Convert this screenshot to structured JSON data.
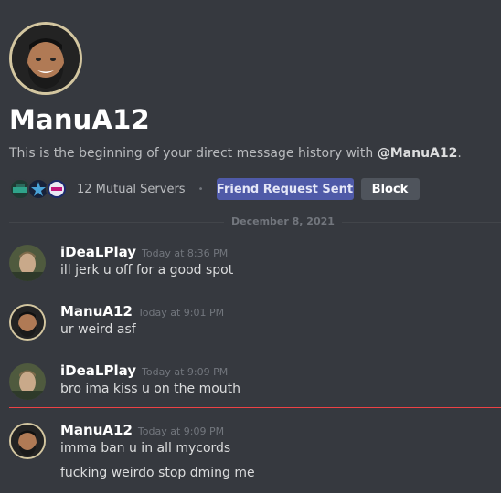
{
  "profile": {
    "username": "ManuA12",
    "intro_prefix": "This is the beginning of your direct message history with ",
    "intro_handle": "@ManuA12",
    "intro_suffix": ".",
    "mutual_servers": "12 Mutual Servers",
    "separator": "•",
    "friend_request_label": "Friend Request Sent",
    "block_label": "Block",
    "server_icons": [
      "server-icon-1",
      "server-icon-2",
      "server-icon-3"
    ]
  },
  "date_divider": "December 8, 2021",
  "messages": [
    {
      "author": "iDeaLPlay",
      "time": "Today at 8:36 PM",
      "lines": [
        "ill jerk u off for a good spot"
      ]
    },
    {
      "author": "ManuA12",
      "time": "Today at 9:01 PM",
      "lines": [
        "ur weird asf"
      ]
    },
    {
      "author": "iDeaLPlay",
      "time": "Today at 9:09 PM",
      "lines": [
        "bro ima kiss u on the mouth"
      ]
    },
    {
      "author": "ManuA12",
      "time": "Today at 9:09 PM",
      "lines": [
        "imma ban u in all mycords",
        "fucking weirdo stop dming me"
      ]
    }
  ],
  "colors": {
    "background": "#36393f",
    "blurple_button": "#4f5aa8",
    "new_messages_line": "#ed4245"
  }
}
